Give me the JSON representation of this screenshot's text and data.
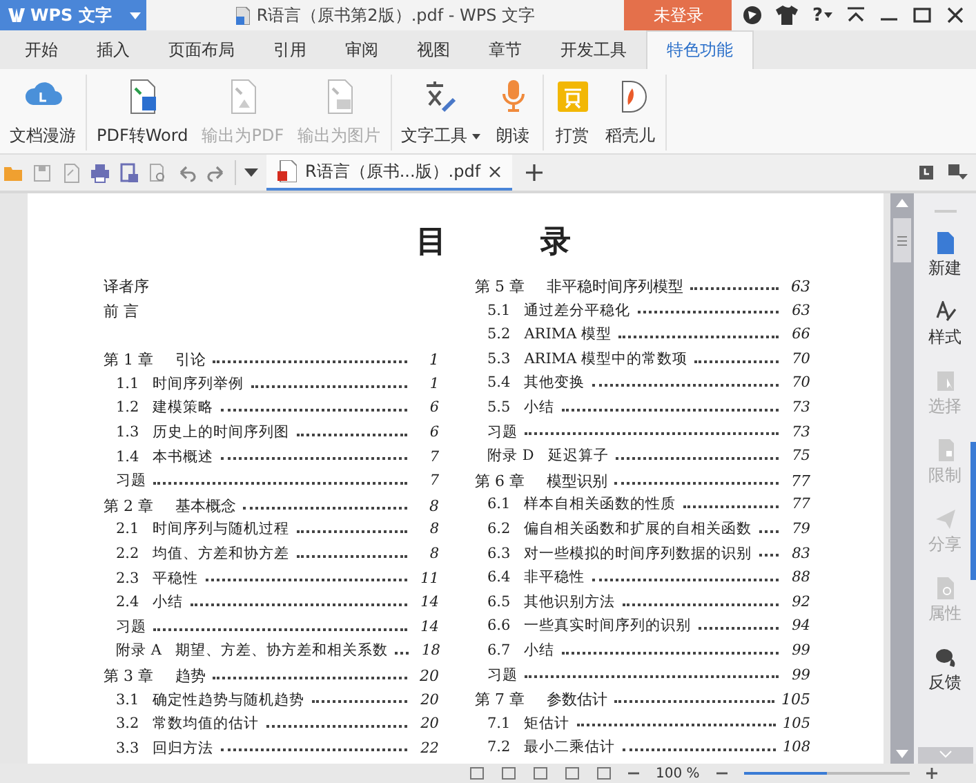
{
  "window": {
    "app_menu": "WPS 文字",
    "title": "R语言（原书第2版）.pdf - WPS 文字",
    "login": "未登录",
    "help": "?"
  },
  "tabs": [
    {
      "label": "开始",
      "selected": false
    },
    {
      "label": "插入",
      "selected": false
    },
    {
      "label": "页面布局",
      "selected": false
    },
    {
      "label": "引用",
      "selected": false
    },
    {
      "label": "审阅",
      "selected": false
    },
    {
      "label": "视图",
      "selected": false
    },
    {
      "label": "章节",
      "selected": false
    },
    {
      "label": "开发工具",
      "selected": false
    },
    {
      "label": "特色功能",
      "selected": true
    }
  ],
  "ribbon": {
    "groups": [
      [
        {
          "label": "文档漫游",
          "kind": "button",
          "disabled": false
        }
      ],
      [
        {
          "label": "PDF转Word",
          "kind": "button",
          "disabled": false
        },
        {
          "label": "输出为PDF",
          "kind": "button",
          "disabled": true
        },
        {
          "label": "输出为图片",
          "kind": "button",
          "disabled": true
        }
      ],
      [
        {
          "label": "文字工具",
          "kind": "dropdown",
          "disabled": false
        },
        {
          "label": "朗读",
          "kind": "button",
          "disabled": false
        }
      ],
      [
        {
          "label": "打赏",
          "kind": "button",
          "disabled": false
        },
        {
          "label": "稻壳儿",
          "kind": "button",
          "disabled": false
        }
      ]
    ]
  },
  "document_tabs": [
    {
      "label": "R语言（原书...版）.pdf",
      "selected": true
    }
  ],
  "document": {
    "title": "目 录",
    "columns": [
      [
        {
          "title": "译者序"
        },
        {
          "title": "前 言"
        },
        {
          "num": "第 1 章",
          "title": "引论",
          "page": "1",
          "children": [
            {
              "num": "1.1",
              "title": "时间序列举例",
              "page": "1"
            },
            {
              "num": "1.2",
              "title": "建模策略",
              "page": "6"
            },
            {
              "num": "1.3",
              "title": "历史上的时间序列图",
              "page": "6"
            },
            {
              "num": "1.4",
              "title": "本书概述",
              "page": "7"
            },
            {
              "title": "习题",
              "page": "7"
            }
          ]
        },
        {
          "num": "第 2 章",
          "title": "基本概念",
          "page": "8",
          "children": [
            {
              "num": "2.1",
              "title": "时间序列与随机过程",
              "page": "8"
            },
            {
              "num": "2.2",
              "title": "均值、方差和协方差",
              "page": "8"
            },
            {
              "num": "2.3",
              "title": "平稳性",
              "page": "11"
            },
            {
              "num": "2.4",
              "title": "小结",
              "page": "14"
            },
            {
              "title": "习题",
              "page": "14"
            },
            {
              "num": "附录 A",
              "title": "期望、方差、协方差和相关系数",
              "page": "18"
            }
          ]
        },
        {
          "num": "第 3 章",
          "title": "趋势",
          "page": "20",
          "children": [
            {
              "num": "3.1",
              "title": "确定性趋势与随机趋势",
              "page": "20"
            },
            {
              "num": "3.2",
              "title": "常数均值的估计",
              "page": "20"
            },
            {
              "num": "3.3",
              "title": "回归方法",
              "page": "22"
            }
          ]
        }
      ],
      [
        {
          "num": "第 5 章",
          "title": "非平稳时间序列模型",
          "page": "63",
          "children": [
            {
              "num": "5.1",
              "title": "通过差分平稳化",
              "page": "63"
            },
            {
              "num": "5.2",
              "title": "ARIMA 模型",
              "page": "66"
            },
            {
              "num": "5.3",
              "title": "ARIMA 模型中的常数项",
              "page": "70"
            },
            {
              "num": "5.4",
              "title": "其他变换",
              "page": "70"
            },
            {
              "num": "5.5",
              "title": "小结",
              "page": "73"
            },
            {
              "title": "习题",
              "page": "73"
            },
            {
              "num": "附录 D",
              "title": "延迟算子",
              "page": "75"
            }
          ]
        },
        {
          "num": "第 6 章",
          "title": "模型识别",
          "page": "77",
          "children": [
            {
              "num": "6.1",
              "title": "样本自相关函数的性质",
              "page": "77"
            },
            {
              "num": "6.2",
              "title": "偏自相关函数和扩展的自相关函数",
              "page": "79"
            },
            {
              "num": "6.3",
              "title": "对一些模拟的时间序列数据的识别",
              "page": "83"
            },
            {
              "num": "6.4",
              "title": "非平稳性",
              "page": "88"
            },
            {
              "num": "6.5",
              "title": "其他识别方法",
              "page": "92"
            },
            {
              "num": "6.6",
              "title": "一些真实时间序列的识别",
              "page": "94"
            },
            {
              "num": "6.7",
              "title": "小结",
              "page": "99"
            },
            {
              "title": "习题",
              "page": "99"
            }
          ]
        },
        {
          "num": "第 7 章",
          "title": "参数估计",
          "page": "105",
          "children": [
            {
              "num": "7.1",
              "title": "矩估计",
              "page": "105"
            },
            {
              "num": "7.2",
              "title": "最小二乘估计",
              "page": "108"
            }
          ]
        }
      ]
    ]
  },
  "side_panel": {
    "items": [
      {
        "label": "新建",
        "disabled": false
      },
      {
        "label": "样式",
        "disabled": false
      },
      {
        "label": "选择",
        "disabled": true
      },
      {
        "label": "限制",
        "disabled": true
      },
      {
        "label": "分享",
        "disabled": true
      },
      {
        "label": "属性",
        "disabled": true
      },
      {
        "label": "反馈",
        "disabled": false
      }
    ]
  },
  "status_bar": {
    "zoom": "100 %",
    "zoom_slider": {
      "level": 0.5
    }
  }
}
